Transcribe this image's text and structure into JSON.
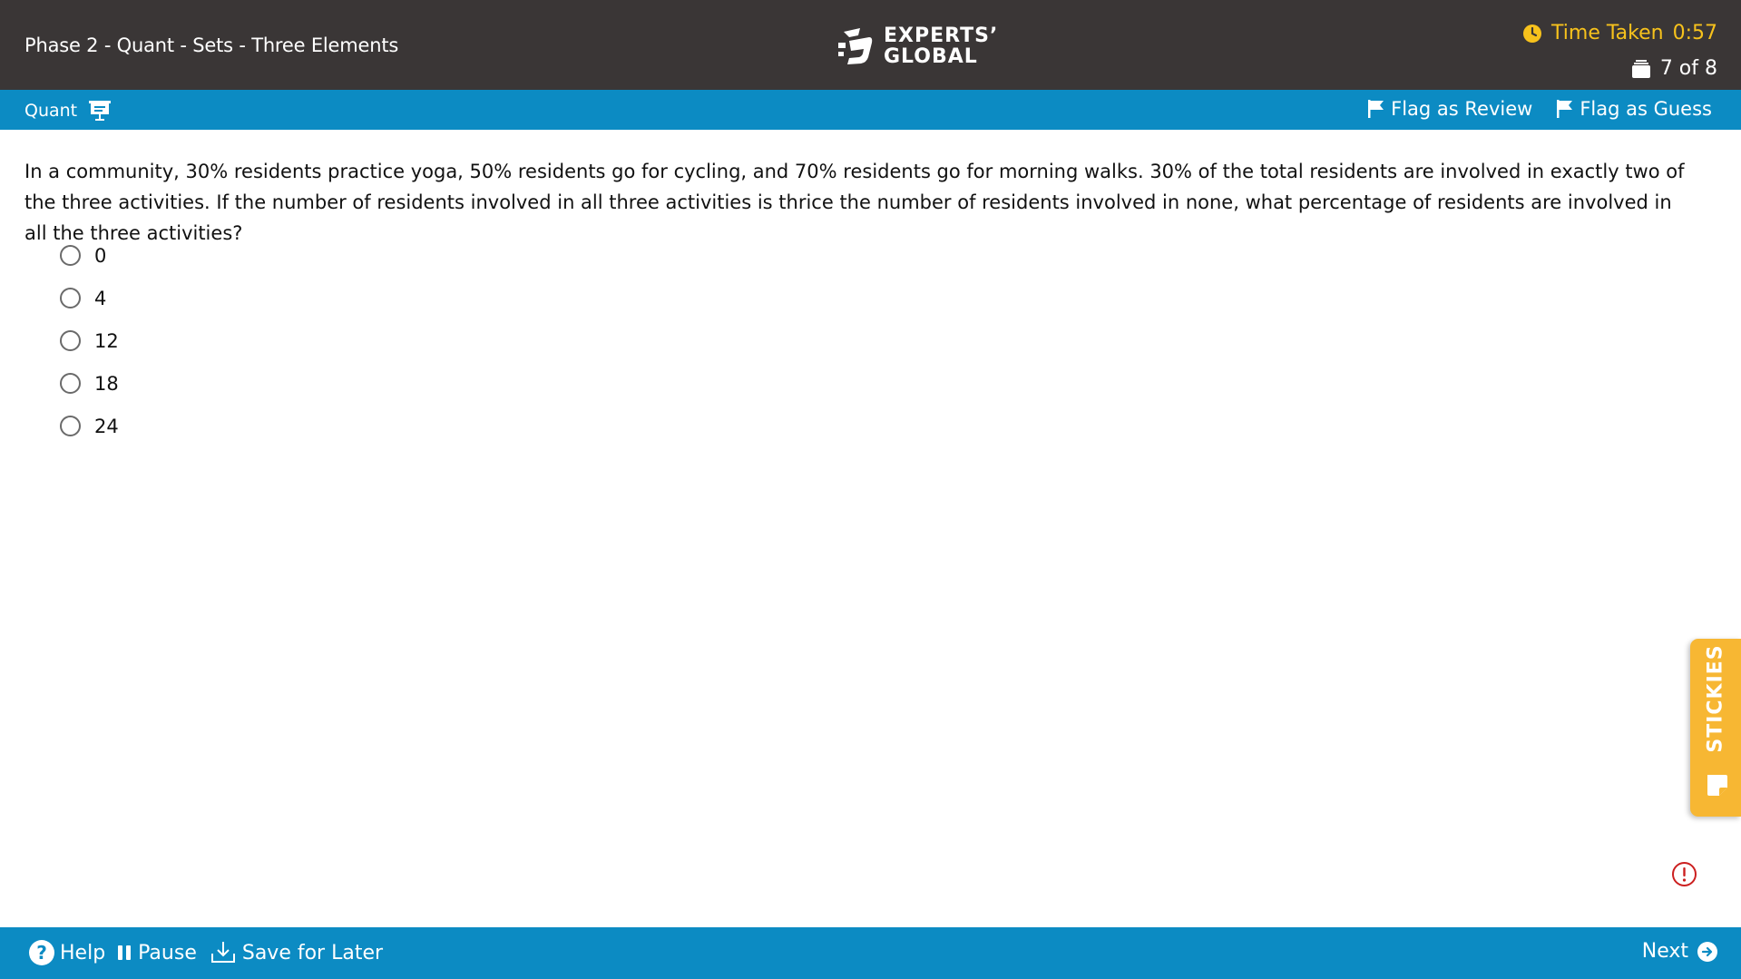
{
  "header": {
    "title": "Phase 2 - Quant - Sets - Three Elements",
    "logo_line1": "EXPERTS’",
    "logo_line2": "GLOBAL",
    "time_label": "Time Taken",
    "time_value": "0:57",
    "question_counter": "7 of 8"
  },
  "subheader": {
    "section_label": "Quant",
    "flag_review_label": "Flag as Review",
    "flag_guess_label": "Flag as Guess"
  },
  "question": {
    "text": "In a community, 30% residents practice yoga, 50% residents go for cycling, and 70% residents go for morning walks. 30% of the total residents are involved in exactly two of the three activities. If the number of residents involved in all three activities is thrice the number of residents involved in none, what percentage of residents are involved in all the three activities?",
    "options": [
      "0",
      "4",
      "12",
      "18",
      "24"
    ]
  },
  "stickies_label": "STICKIES",
  "footer": {
    "help_label": "Help",
    "pause_label": "Pause",
    "save_label": "Save for Later",
    "next_label": "Next"
  },
  "colors": {
    "top_bar": "#3a3636",
    "accent_bar": "#0c8bc3",
    "timer": "#f7c21c",
    "stickies": "#f7b733",
    "alert": "#cc1f1f"
  }
}
